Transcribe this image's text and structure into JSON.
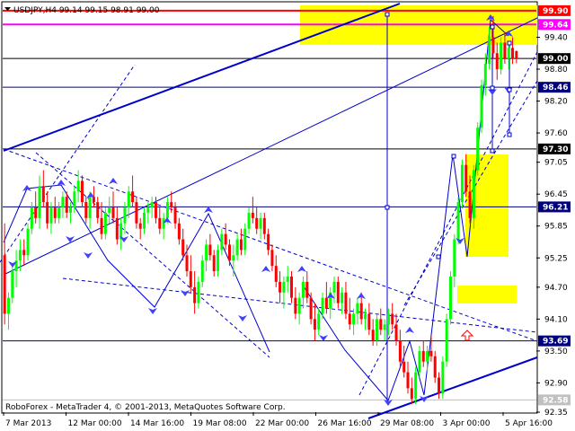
{
  "chart_data": {
    "type": "candlestick",
    "symbol": "USDJPY",
    "timeframe": "H4",
    "title": "USDJPY,H4  99.14 99.15 98.91 99.00",
    "ohlc": {
      "open": 99.14,
      "high": 99.15,
      "low": 98.91,
      "close": 99.0
    },
    "footer": "RoboForex - MetaTrader 4, © 2001-2013, MetaQuotes Software Corp.",
    "ylim": [
      92.35,
      100.05
    ],
    "y_ticks": [
      99.4,
      98.8,
      98.2,
      97.6,
      97.05,
      96.45,
      95.85,
      95.25,
      94.7,
      94.1,
      93.5,
      92.9,
      92.35
    ],
    "x_ticks": [
      "7 Mar 2013",
      "12 Mar 00:00",
      "14 Mar 16:00",
      "19 Mar 08:00",
      "22 Mar 00:00",
      "26 Mar 16:00",
      "29 Mar 08:00",
      "3 Apr 00:00",
      "5 Apr 16:00"
    ],
    "price_levels": [
      {
        "value": 99.9,
        "label": "99.90",
        "color": "#ff0000",
        "bg": "#ff0000",
        "text": "#ffffff"
      },
      {
        "value": 99.64,
        "label": "99.64",
        "color": "#ff00ff",
        "bg": "#ff00ff",
        "text": "#ffffff"
      },
      {
        "value": 99.0,
        "label": "99.00",
        "color": "#000000",
        "bg": "#000000",
        "text": "#ffffff"
      },
      {
        "value": 98.46,
        "label": "98.46",
        "color": "#00007f",
        "bg": "#00007f",
        "text": "#ffffff"
      },
      {
        "value": 97.3,
        "label": "97.30",
        "color": "#000000",
        "bg": "#000000",
        "text": "#ffffff"
      },
      {
        "value": 96.21,
        "label": "96.21",
        "color": "#00007f",
        "bg": "#00007f",
        "text": "#ffffff"
      },
      {
        "value": 93.69,
        "label": "93.69",
        "color": "#00007f",
        "bg": "#00007f",
        "text": "#ffffff"
      },
      {
        "value": 92.58,
        "label": "92.58",
        "color": "#c0c0c0",
        "bg": "#c0c0c0",
        "text": "#ffffff"
      }
    ],
    "colors": {
      "bull": "#00ff00",
      "bear": "#ff0000",
      "line": "#0000cc",
      "zone": "#ffff00",
      "grid": "#c0c0c0",
      "text": "#000000"
    },
    "candles": [
      [
        0,
        95.3,
        95.9,
        94.0,
        94.2
      ],
      [
        1,
        94.2,
        94.6,
        93.9,
        94.5
      ],
      [
        2,
        94.5,
        95.1,
        94.4,
        95.0
      ],
      [
        3,
        95.0,
        95.4,
        94.7,
        95.2
      ],
      [
        4,
        95.2,
        95.6,
        95.0,
        95.4
      ],
      [
        5,
        95.4,
        95.6,
        95.1,
        95.3
      ],
      [
        6,
        95.3,
        95.9,
        95.2,
        95.8
      ],
      [
        7,
        95.8,
        96.3,
        95.7,
        96.2
      ],
      [
        8,
        96.2,
        96.5,
        95.9,
        96.0
      ],
      [
        9,
        96.0,
        96.8,
        95.8,
        96.6
      ],
      [
        10,
        96.6,
        96.9,
        96.2,
        96.3
      ],
      [
        11,
        96.3,
        96.5,
        95.8,
        95.9
      ],
      [
        12,
        95.9,
        96.3,
        95.7,
        96.2
      ],
      [
        13,
        96.2,
        96.4,
        95.9,
        96.0
      ],
      [
        14,
        96.0,
        96.3,
        95.9,
        96.2
      ],
      [
        15,
        96.2,
        96.5,
        96.0,
        96.4
      ],
      [
        16,
        96.4,
        96.5,
        96.0,
        96.1
      ],
      [
        17,
        96.1,
        96.3,
        95.9,
        96.2
      ],
      [
        18,
        96.2,
        96.6,
        96.1,
        96.5
      ],
      [
        19,
        96.5,
        96.9,
        96.3,
        96.7
      ],
      [
        20,
        96.7,
        96.8,
        96.2,
        96.3
      ],
      [
        21,
        96.3,
        96.4,
        95.9,
        96.0
      ],
      [
        22,
        96.0,
        96.5,
        95.8,
        96.4
      ],
      [
        23,
        96.4,
        96.6,
        96.2,
        96.3
      ],
      [
        24,
        96.3,
        96.4,
        95.9,
        96.0
      ],
      [
        25,
        96.0,
        96.3,
        95.6,
        95.7
      ],
      [
        26,
        95.7,
        96.2,
        95.6,
        96.1
      ],
      [
        27,
        96.1,
        96.4,
        95.9,
        96.2
      ],
      [
        28,
        96.2,
        96.5,
        95.9,
        96.0
      ],
      [
        29,
        96.0,
        96.2,
        95.5,
        95.6
      ],
      [
        30,
        95.6,
        96.0,
        95.4,
        95.9
      ],
      [
        31,
        95.9,
        96.3,
        95.7,
        96.2
      ],
      [
        32,
        96.2,
        96.6,
        96.0,
        96.5
      ],
      [
        33,
        96.5,
        96.8,
        96.2,
        96.3
      ],
      [
        34,
        96.3,
        96.4,
        95.8,
        95.9
      ],
      [
        35,
        95.9,
        96.0,
        95.6,
        95.8
      ],
      [
        36,
        95.8,
        96.2,
        95.7,
        96.1
      ],
      [
        37,
        96.1,
        96.3,
        95.9,
        96.2
      ],
      [
        38,
        96.2,
        96.4,
        96.0,
        96.3
      ],
      [
        39,
        96.3,
        96.4,
        95.9,
        96.0
      ],
      [
        40,
        96.0,
        96.2,
        95.7,
        95.8
      ],
      [
        41,
        95.8,
        96.1,
        95.6,
        96.0
      ],
      [
        42,
        96.0,
        96.4,
        95.9,
        96.3
      ],
      [
        43,
        96.3,
        96.5,
        96.1,
        96.2
      ],
      [
        44,
        96.2,
        96.3,
        95.8,
        95.9
      ],
      [
        45,
        95.9,
        96.0,
        95.5,
        95.6
      ],
      [
        46,
        95.6,
        95.8,
        95.2,
        95.3
      ],
      [
        47,
        95.3,
        95.5,
        94.9,
        95.0
      ],
      [
        48,
        95.0,
        95.3,
        94.6,
        94.7
      ],
      [
        49,
        94.7,
        95.0,
        94.2,
        94.4
      ],
      [
        50,
        94.4,
        94.9,
        94.3,
        94.8
      ],
      [
        51,
        94.8,
        95.3,
        94.7,
        95.2
      ],
      [
        52,
        95.2,
        95.6,
        95.0,
        95.5
      ],
      [
        53,
        95.5,
        95.7,
        95.2,
        95.3
      ],
      [
        54,
        95.3,
        95.4,
        94.9,
        95.0
      ],
      [
        55,
        95.0,
        95.5,
        94.9,
        95.4
      ],
      [
        56,
        95.4,
        95.8,
        95.3,
        95.7
      ],
      [
        57,
        95.7,
        95.9,
        95.4,
        95.5
      ],
      [
        58,
        95.5,
        95.6,
        95.1,
        95.2
      ],
      [
        59,
        95.2,
        95.5,
        94.9,
        95.3
      ],
      [
        60,
        95.3,
        95.7,
        95.2,
        95.6
      ],
      [
        61,
        95.6,
        95.8,
        95.3,
        95.4
      ],
      [
        62,
        95.4,
        95.9,
        95.3,
        95.8
      ],
      [
        63,
        95.8,
        96.2,
        95.7,
        96.1
      ],
      [
        64,
        96.1,
        96.4,
        95.9,
        96.0
      ],
      [
        65,
        96.0,
        96.2,
        95.7,
        95.8
      ],
      [
        66,
        95.8,
        96.1,
        95.6,
        96.0
      ],
      [
        67,
        96.0,
        96.1,
        95.6,
        95.7
      ],
      [
        68,
        95.7,
        95.8,
        95.3,
        95.4
      ],
      [
        69,
        95.4,
        95.5,
        95.0,
        95.1
      ],
      [
        70,
        95.1,
        95.3,
        94.7,
        94.8
      ],
      [
        71,
        94.8,
        95.0,
        94.4,
        94.6
      ],
      [
        72,
        94.6,
        94.9,
        94.3,
        94.8
      ],
      [
        73,
        94.8,
        95.1,
        94.6,
        94.9
      ],
      [
        74,
        94.9,
        95.0,
        94.4,
        94.5
      ],
      [
        75,
        94.5,
        94.7,
        94.1,
        94.2
      ],
      [
        76,
        94.2,
        94.6,
        94.0,
        94.5
      ],
      [
        77,
        94.5,
        94.9,
        94.3,
        94.8
      ],
      [
        78,
        94.8,
        95.0,
        94.4,
        94.5
      ],
      [
        79,
        94.5,
        94.6,
        94.0,
        94.1
      ],
      [
        80,
        94.1,
        94.4,
        93.7,
        93.9
      ],
      [
        81,
        93.9,
        94.3,
        93.8,
        94.2
      ],
      [
        82,
        94.2,
        94.6,
        94.1,
        94.5
      ],
      [
        83,
        94.5,
        94.8,
        94.2,
        94.3
      ],
      [
        84,
        94.3,
        94.7,
        94.1,
        94.6
      ],
      [
        85,
        94.6,
        94.9,
        94.4,
        94.8
      ],
      [
        86,
        94.8,
        94.9,
        94.3,
        94.4
      ],
      [
        87,
        94.4,
        94.7,
        94.2,
        94.6
      ],
      [
        88,
        94.6,
        94.8,
        94.1,
        94.2
      ],
      [
        89,
        94.2,
        94.5,
        93.9,
        94.0
      ],
      [
        90,
        94.0,
        94.3,
        93.8,
        94.2
      ],
      [
        91,
        94.2,
        94.5,
        94.0,
        94.4
      ],
      [
        92,
        94.4,
        94.6,
        94.0,
        94.1
      ],
      [
        93,
        94.1,
        94.3,
        93.9,
        94.2
      ],
      [
        94,
        94.2,
        94.4,
        93.8,
        93.9
      ],
      [
        95,
        93.9,
        94.1,
        93.6,
        93.7
      ],
      [
        96,
        93.7,
        94.2,
        93.6,
        94.1
      ],
      [
        97,
        94.1,
        94.3,
        93.8,
        93.9
      ],
      [
        98,
        93.9,
        94.1,
        93.7,
        94.0
      ],
      [
        99,
        94.0,
        94.3,
        93.8,
        94.2
      ],
      [
        100,
        94.2,
        94.4,
        93.9,
        94.0
      ],
      [
        101,
        94.0,
        94.2,
        93.6,
        93.7
      ],
      [
        102,
        93.7,
        93.9,
        93.2,
        93.3
      ],
      [
        103,
        93.3,
        93.6,
        93.0,
        93.1
      ],
      [
        104,
        93.1,
        93.3,
        92.7,
        92.8
      ],
      [
        105,
        92.8,
        93.0,
        92.5,
        92.6
      ],
      [
        106,
        92.6,
        93.2,
        92.5,
        93.1
      ],
      [
        107,
        93.1,
        93.6,
        93.0,
        93.5
      ],
      [
        108,
        93.5,
        93.7,
        93.2,
        93.3
      ],
      [
        109,
        93.3,
        93.6,
        93.1,
        93.5
      ],
      [
        110,
        93.5,
        93.8,
        93.3,
        93.4
      ],
      [
        111,
        93.4,
        93.5,
        92.9,
        93.0
      ],
      [
        112,
        93.0,
        93.1,
        92.6,
        92.7
      ],
      [
        113,
        92.7,
        93.4,
        92.6,
        93.3
      ],
      [
        114,
        93.3,
        94.2,
        93.2,
        94.1
      ],
      [
        115,
        94.1,
        95.0,
        94.0,
        94.9
      ],
      [
        116,
        94.9,
        95.7,
        94.7,
        95.6
      ],
      [
        117,
        95.6,
        96.4,
        95.5,
        96.3
      ],
      [
        118,
        96.3,
        97.1,
        96.2,
        97.0
      ],
      [
        119,
        97.0,
        97.2,
        96.4,
        96.5
      ],
      [
        120,
        96.5,
        96.8,
        95.9,
        96.0
      ],
      [
        121,
        96.0,
        97.0,
        95.8,
        96.9
      ],
      [
        122,
        96.9,
        97.8,
        96.8,
        97.7
      ],
      [
        123,
        97.7,
        98.6,
        97.6,
        98.5
      ],
      [
        124,
        98.5,
        99.1,
        98.3,
        98.9
      ],
      [
        125,
        98.9,
        99.6,
        98.8,
        99.4
      ],
      [
        126,
        99.4,
        99.8,
        99.0,
        99.1
      ],
      [
        127,
        99.1,
        99.3,
        98.6,
        98.8
      ],
      [
        128,
        98.8,
        99.4,
        98.7,
        99.3
      ],
      [
        129,
        99.3,
        99.5,
        98.9,
        99.0
      ],
      [
        130,
        99.0,
        99.3,
        98.8,
        99.2
      ],
      [
        131,
        99.2,
        99.4,
        98.9,
        99.0
      ],
      [
        132,
        99.14,
        99.15,
        98.91,
        99.0
      ]
    ]
  }
}
